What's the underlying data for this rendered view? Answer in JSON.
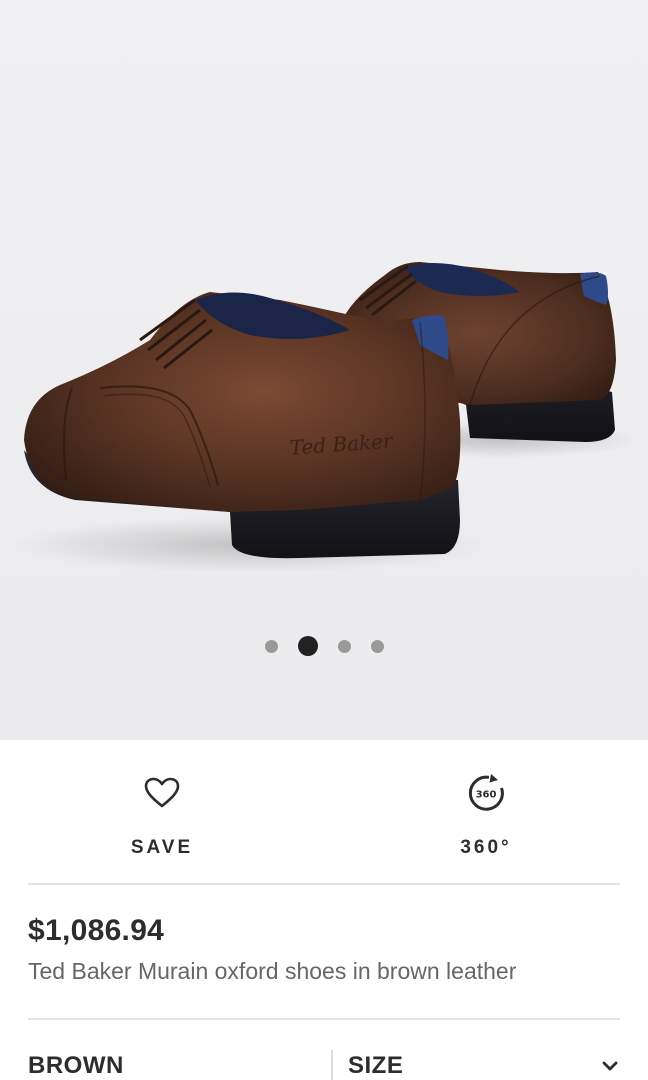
{
  "gallery": {
    "image_alt": "Ted Baker Murain oxford shoes in brown leather",
    "brand_emboss": "Ted Baker",
    "dots": [
      {
        "active": false
      },
      {
        "active": true
      },
      {
        "active": false
      },
      {
        "active": false
      }
    ]
  },
  "actions": {
    "save": {
      "label": "SAVE",
      "icon": "heart-icon"
    },
    "view360": {
      "label": "360°",
      "icon_text": "360",
      "icon": "rotate-360-icon"
    }
  },
  "product": {
    "price": "$1,086.94",
    "title": "Ted Baker Murain oxford shoes in brown leather"
  },
  "selectors": {
    "colour": "BROWN",
    "size": {
      "label": "SIZE",
      "icon": "chevron-down-icon"
    }
  },
  "colors": {
    "leather": "#4a2c1f",
    "sole": "#1f1f24",
    "lining": "#2f4a8a",
    "text": "#2d2d2d",
    "muted": "#666666"
  }
}
